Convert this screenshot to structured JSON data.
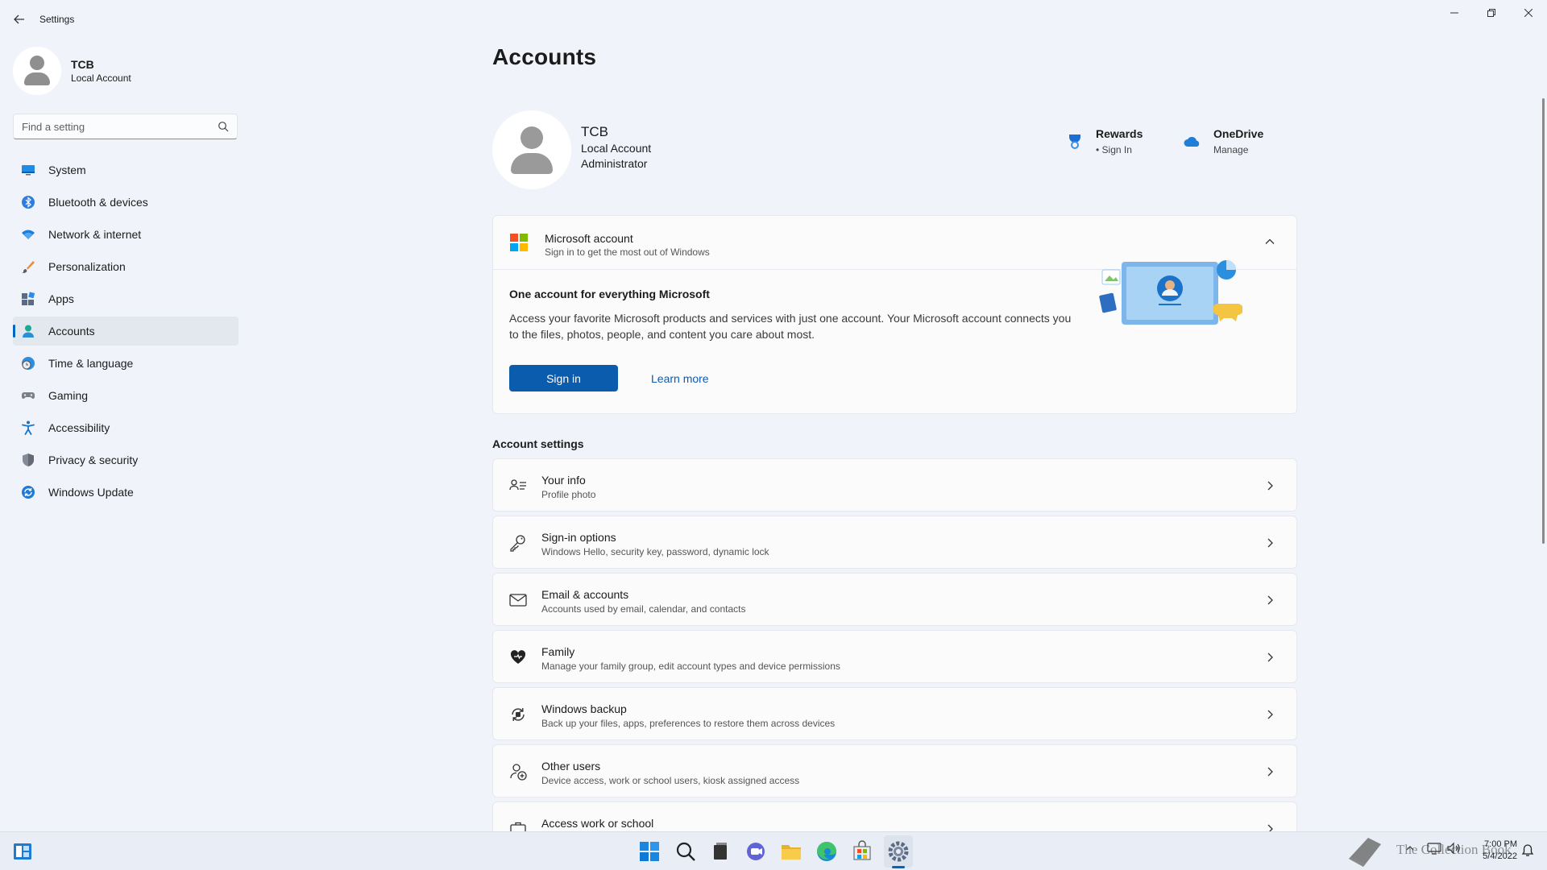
{
  "window": {
    "app_title": "Settings",
    "controls": {
      "minimize": "—",
      "maximize": "❐",
      "close": "✕"
    }
  },
  "sidebar": {
    "profile": {
      "name": "TCB",
      "type": "Local Account"
    },
    "search": {
      "placeholder": "Find a setting"
    },
    "items": [
      {
        "label": "System",
        "icon": "system-icon"
      },
      {
        "label": "Bluetooth & devices",
        "icon": "bluetooth-icon"
      },
      {
        "label": "Network & internet",
        "icon": "wifi-icon"
      },
      {
        "label": "Personalization",
        "icon": "brush-icon"
      },
      {
        "label": "Apps",
        "icon": "apps-icon"
      },
      {
        "label": "Accounts",
        "icon": "accounts-icon",
        "active": true
      },
      {
        "label": "Time & language",
        "icon": "globe-clock-icon"
      },
      {
        "label": "Gaming",
        "icon": "gamepad-icon"
      },
      {
        "label": "Accessibility",
        "icon": "accessibility-icon"
      },
      {
        "label": "Privacy & security",
        "icon": "shield-icon"
      },
      {
        "label": "Windows Update",
        "icon": "update-icon"
      }
    ]
  },
  "main": {
    "title": "Accounts",
    "account": {
      "name": "TCB",
      "type": "Local Account",
      "role": "Administrator"
    },
    "rewards": {
      "title": "Rewards",
      "sub": "• Sign In"
    },
    "onedrive": {
      "title": "OneDrive",
      "sub": "Manage"
    },
    "microsoft_account": {
      "title": "Microsoft account",
      "subtitle": "Sign in to get the most out of Windows",
      "body_title": "One account for everything Microsoft",
      "body_text": "Access your favorite Microsoft products and services with just one account. Your Microsoft account connects you to the files, photos, people, and content you care about most.",
      "sign_in": "Sign in",
      "learn_more": "Learn more"
    },
    "section_title": "Account settings",
    "settings": [
      {
        "title": "Your info",
        "sub": "Profile photo",
        "icon": "person-card-icon"
      },
      {
        "title": "Sign-in options",
        "sub": "Windows Hello, security key, password, dynamic lock",
        "icon": "key-icon"
      },
      {
        "title": "Email & accounts",
        "sub": "Accounts used by email, calendar, and contacts",
        "icon": "mail-icon"
      },
      {
        "title": "Family",
        "sub": "Manage your family group, edit account types and device permissions",
        "icon": "heart-icon"
      },
      {
        "title": "Windows backup",
        "sub": "Back up your files, apps, preferences to restore them across devices",
        "icon": "backup-icon"
      },
      {
        "title": "Other users",
        "sub": "Device access, work or school users, kiosk assigned access",
        "icon": "person-add-icon"
      },
      {
        "title": "Access work or school",
        "sub": "",
        "icon": "briefcase-icon"
      }
    ]
  },
  "taskbar": {
    "watermark": "The Collection Book",
    "time": "7:00 PM",
    "date": "5/4/2022",
    "accent": "#0067c0"
  }
}
